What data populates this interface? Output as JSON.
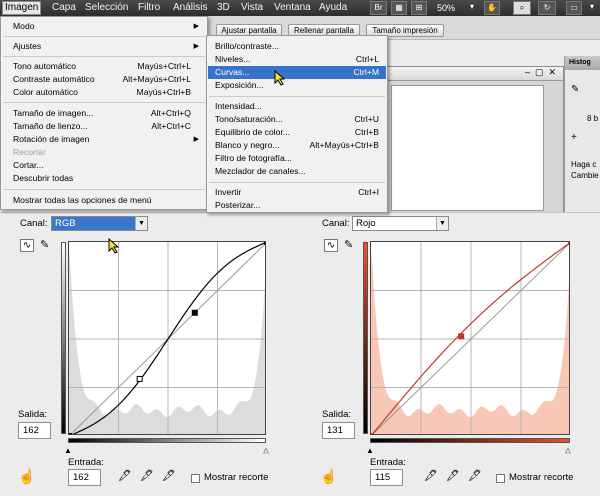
{
  "menubar": {
    "items": [
      "Imagen",
      "Capa",
      "Selección",
      "Filtro",
      "Análisis",
      "3D",
      "Vista",
      "Ventana",
      "Ayuda"
    ],
    "zoom": "50%",
    "icon_labels": [
      "Br"
    ]
  },
  "options_bar": {
    "buttons": [
      "Ajustar pantalla",
      "Rellenar pantalla",
      "Tamaño impresión"
    ]
  },
  "image_menu": {
    "items": [
      {
        "label": "Modo",
        "shortcut": "",
        "submenu": true,
        "disabled": false
      },
      {
        "label": "Ajustes",
        "shortcut": "",
        "submenu": true,
        "disabled": false
      },
      {
        "label": "Tono automático",
        "shortcut": "Mayús+Ctrl+L",
        "submenu": false,
        "disabled": false
      },
      {
        "label": "Contraste automático",
        "shortcut": "Alt+Mayús+Ctrl+L",
        "submenu": false,
        "disabled": false
      },
      {
        "label": "Color automático",
        "shortcut": "Mayús+Ctrl+B",
        "submenu": false,
        "disabled": false
      },
      {
        "label": "Tamaño de imagen...",
        "shortcut": "Alt+Ctrl+Q",
        "submenu": false,
        "disabled": false
      },
      {
        "label": "Tamaño de lienzo...",
        "shortcut": "Alt+Ctrl+C",
        "submenu": false,
        "disabled": false
      },
      {
        "label": "Rotación de imagen",
        "shortcut": "",
        "submenu": true,
        "disabled": false
      },
      {
        "label": "Recortar",
        "shortcut": "",
        "submenu": false,
        "disabled": true
      },
      {
        "label": "Cortar...",
        "shortcut": "",
        "submenu": false,
        "disabled": false
      },
      {
        "label": "Descubrir todas",
        "shortcut": "",
        "submenu": false,
        "disabled": false
      },
      {
        "label": "Mostrar todas las opciones de menú",
        "shortcut": "",
        "submenu": false,
        "disabled": false
      }
    ]
  },
  "ajustes_submenu": {
    "items": [
      {
        "label": "Brillo/contraste...",
        "shortcut": ""
      },
      {
        "label": "Niveles...",
        "shortcut": "Ctrl+L"
      },
      {
        "label": "Curvas...",
        "shortcut": "Ctrl+M"
      },
      {
        "label": "Exposición...",
        "shortcut": ""
      },
      {
        "label": "Intensidad...",
        "shortcut": ""
      },
      {
        "label": "Tono/saturación...",
        "shortcut": "Ctrl+U"
      },
      {
        "label": "Equilibrio de color...",
        "shortcut": "Ctrl+B"
      },
      {
        "label": "Blanco y negro...",
        "shortcut": "Alt+Mayús+Ctrl+B"
      },
      {
        "label": "Filtro de fotografía...",
        "shortcut": ""
      },
      {
        "label": "Mezclador de canales...",
        "shortcut": ""
      },
      {
        "label": "Invertir",
        "shortcut": "Ctrl+I"
      },
      {
        "label": "Posterizar...",
        "shortcut": ""
      }
    ],
    "highlighted": "Curvas..."
  },
  "histogram_panel": {
    "tab": "Histog",
    "value": "8 b",
    "lines": [
      "Haga c",
      "Cambie"
    ]
  },
  "curves_left": {
    "channel_label": "Canal:",
    "channel": "RGB",
    "output_label": "Salida:",
    "output": "162",
    "input_label": "Entrada:",
    "input": "162",
    "clipping_label": "Mostrar recorte",
    "color": "#000000",
    "fill": "#dcdcdc"
  },
  "curves_right": {
    "channel_label": "Canal:",
    "channel": "Rojo",
    "output_label": "Salida:",
    "output": "131",
    "input_label": "Entrada:",
    "input": "115",
    "clipping_label": "Mostrar recorte",
    "color": "#c0392b",
    "fill": "#f8c7b6"
  },
  "icons": {
    "curve_tool": "curve-point-icon",
    "pencil": "pencil-icon",
    "eyedroppers": [
      "black-eyedropper-icon",
      "gray-eyedropper-icon",
      "white-eyedropper-icon"
    ],
    "hand": "hand-adjust-icon"
  }
}
